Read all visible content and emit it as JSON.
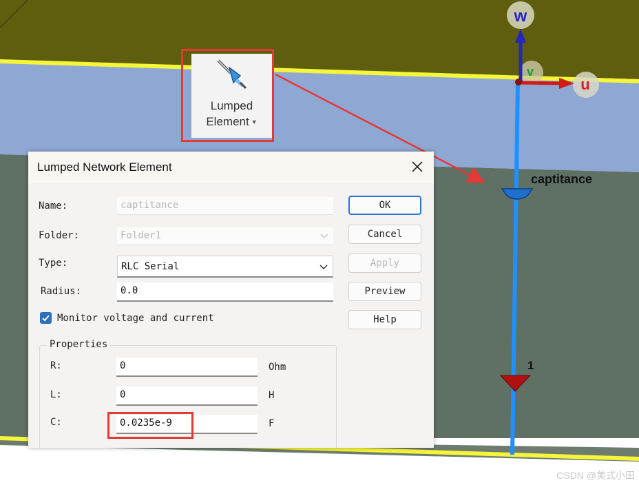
{
  "ribbon": {
    "button_label_line1": "Lumped",
    "button_label_line2": "Element",
    "icon": "lumped-element-icon"
  },
  "scene": {
    "axis_w": "w",
    "axis_u": "u",
    "axis_v": "v",
    "element_label": "captitance",
    "port_label": "1"
  },
  "dialog": {
    "title": "Lumped Network Element",
    "name_label": "Name:",
    "name_value": "captitance",
    "folder_label": "Folder:",
    "folder_value": "Folder1",
    "type_label": "Type:",
    "type_value": "RLC Serial",
    "radius_label": "Radius:",
    "radius_value": "0.0",
    "monitor_label": "Monitor voltage and current",
    "monitor_checked": true,
    "buttons": {
      "ok": "OK",
      "cancel": "Cancel",
      "apply": "Apply",
      "preview": "Preview",
      "help": "Help"
    },
    "properties": {
      "title": "Properties",
      "r_label": "R:",
      "r_value": "0",
      "r_unit": "Ohm",
      "l_label": "L:",
      "l_value": "0",
      "l_unit": "H",
      "c_label": "C:",
      "c_value": "0.0235e-9",
      "c_unit": "F"
    }
  },
  "watermark": "CSDN @美式小田",
  "colors": {
    "dark_layer": "#5e5e0e",
    "blue_layer": "#8fa8d3",
    "gray_layer": "#5f7065",
    "yellow_edge": "#f5f53a",
    "wire": "#1e90ff",
    "highlight": "#e53935",
    "accent": "#2c6fbf"
  }
}
